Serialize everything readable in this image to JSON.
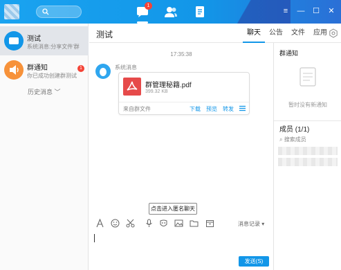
{
  "titlebar": {
    "tabs": [
      {
        "name": "messages",
        "badge": "1"
      },
      {
        "name": "contacts",
        "badge": null
      },
      {
        "name": "files",
        "badge": null
      }
    ],
    "controls": {
      "settings": "≡",
      "minimize": "—",
      "maximize": "☐",
      "close": "✕"
    }
  },
  "sidebar": {
    "conversations": [
      {
        "name": "测试",
        "preview": "系统消息:分享文件'群",
        "active": true,
        "badge": null,
        "color": "#1296e8"
      },
      {
        "name": "群通知",
        "preview": "你已成功创建群测试",
        "active": false,
        "badge": "1",
        "color": "#f7923a"
      }
    ],
    "history_label": "历史消息"
  },
  "chat": {
    "title": "测试",
    "tabs": [
      "聊天",
      "公告",
      "文件",
      "应用"
    ],
    "active_tab": 0,
    "time": "17:35:38",
    "sender": "系统消息",
    "file": {
      "name": "群管理秘籍.pdf",
      "size": "399.32 KB",
      "source": "来自群文件",
      "actions": [
        "下载",
        "预览",
        "转发"
      ]
    }
  },
  "toolbar": {
    "icons": [
      "font-icon",
      "emoji-icon",
      "screenshot-icon",
      "voice-icon",
      "anonymous-icon",
      "image-icon",
      "folder-icon",
      "calendar-icon"
    ],
    "history_label": "消息记录",
    "tooltip": "点击进入匿名聊天"
  },
  "input": {
    "value": "",
    "send_label": "发送(S)"
  },
  "right_panel": {
    "notice_title": "群通知",
    "notice_empty": "暂时没有新通知",
    "members_title": "成员 (1/1)",
    "members_search": "搜索成员"
  },
  "colors": {
    "accent": "#1296e8",
    "badge": "#f44336",
    "pdf": "#e64a4a"
  }
}
